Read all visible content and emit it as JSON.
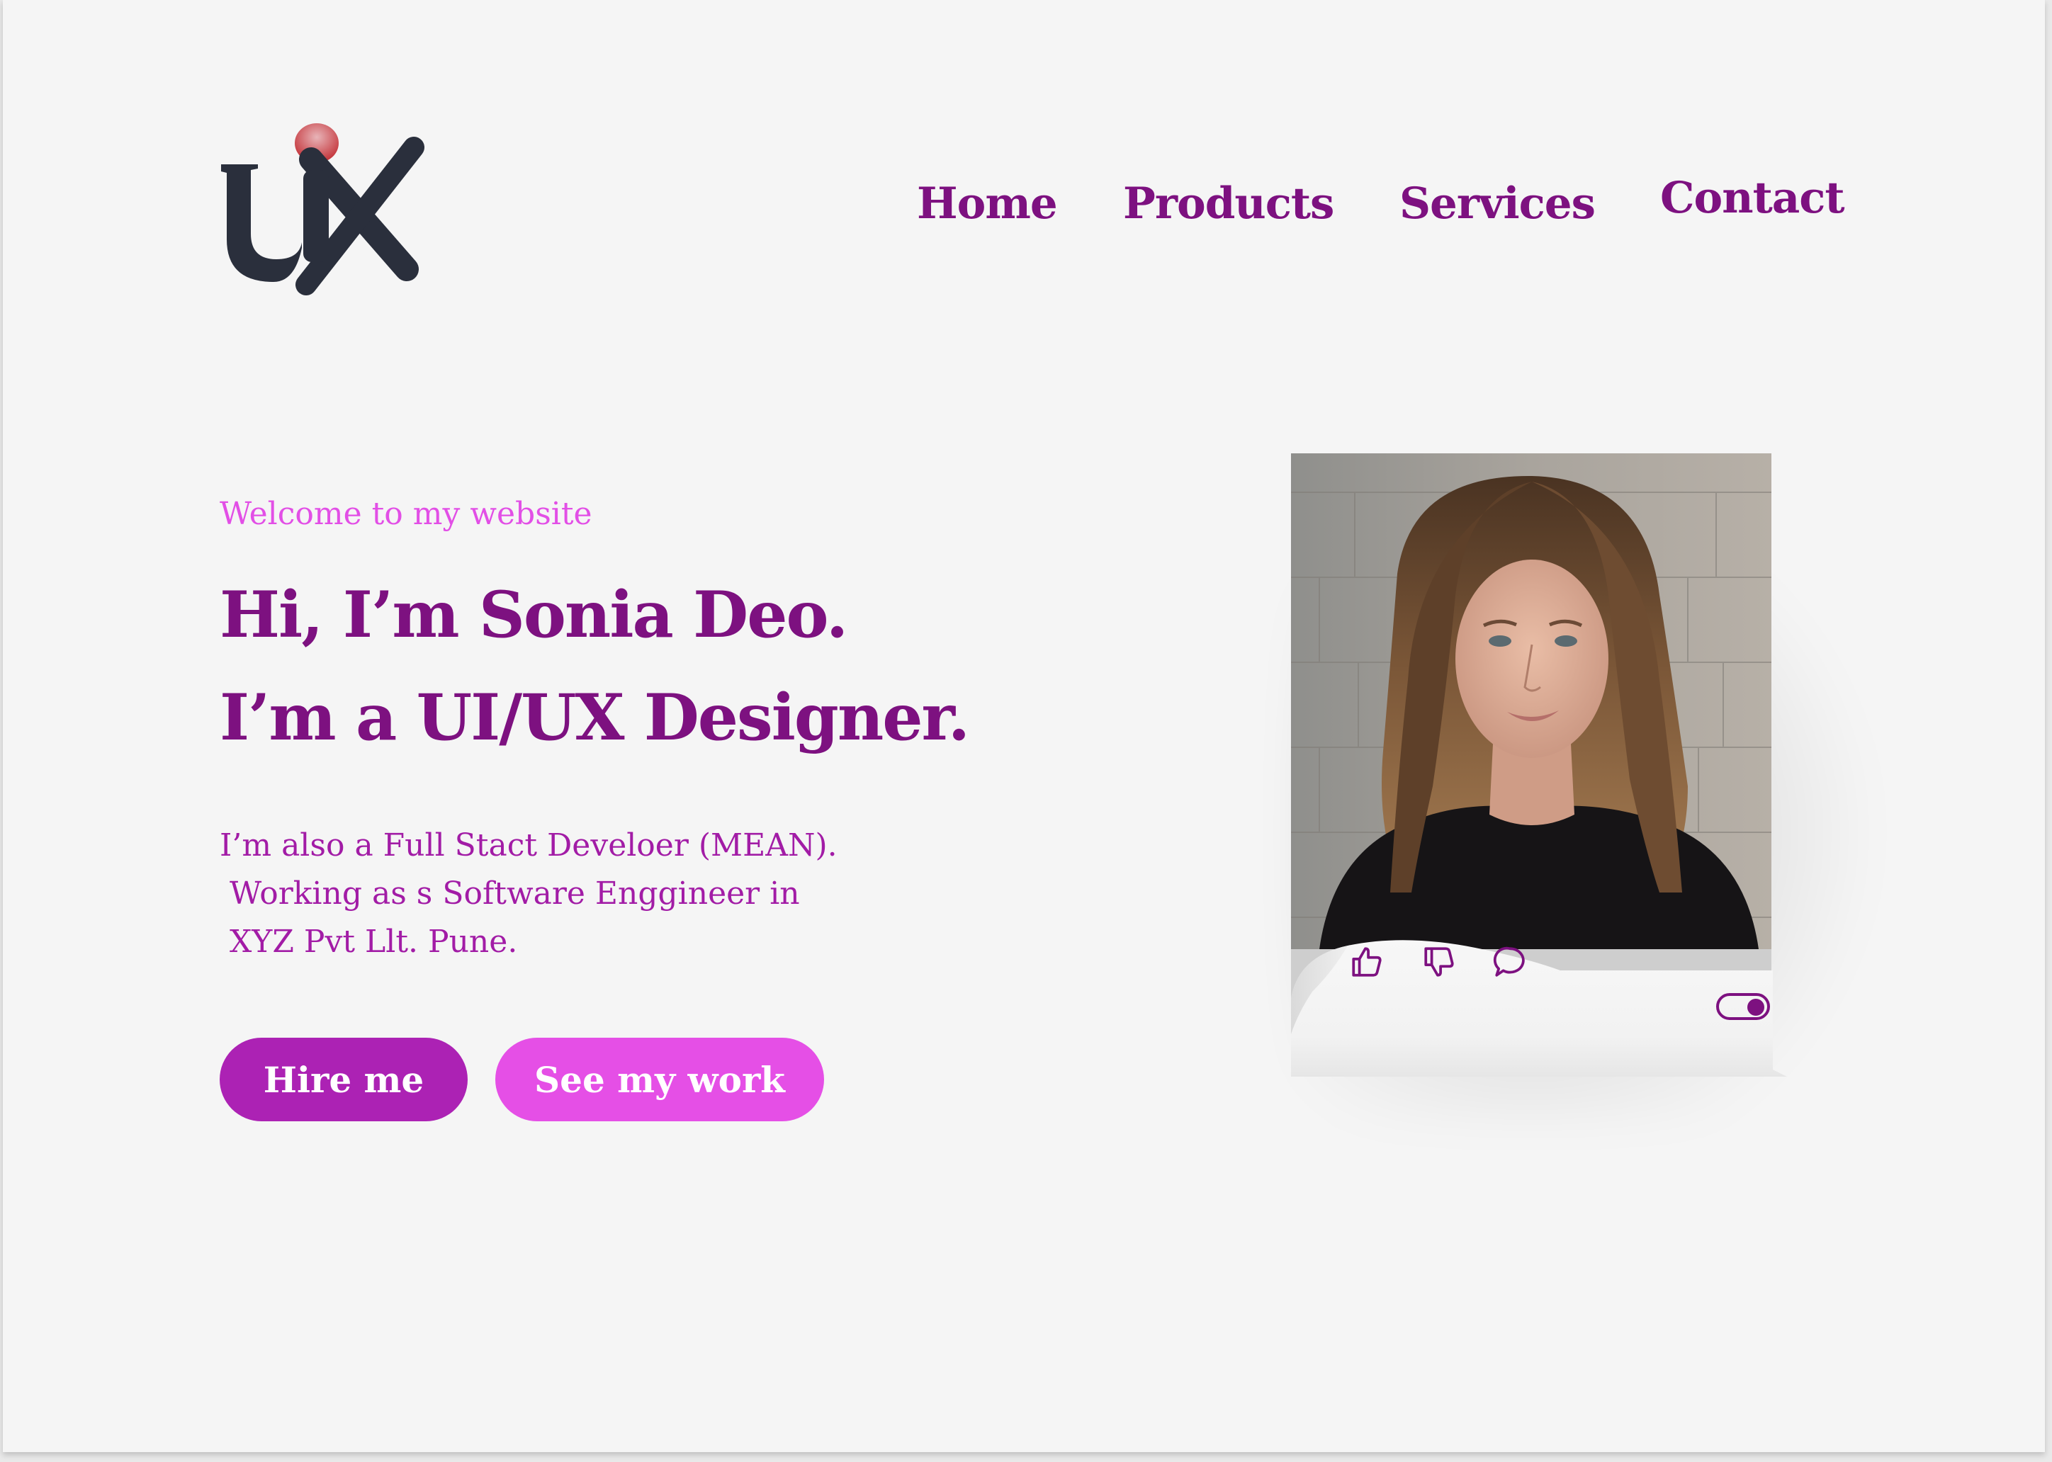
{
  "logo": {
    "text": "UX",
    "colors": {
      "letters": "#2a2f3c",
      "dot_top": "#e29aa0",
      "dot_bottom": "#c0272d"
    }
  },
  "nav": {
    "items": [
      {
        "label": "Home"
      },
      {
        "label": "Products"
      },
      {
        "label": "Services"
      },
      {
        "label": "Contact"
      }
    ]
  },
  "hero": {
    "welcome": "Welcome to my website",
    "headline_line1": "Hi, I’m Sonia Deo.",
    "headline_line2": "I’m a UI/UX Designer.",
    "bio_line1": "I’m also a Full Stact Develoer (MEAN).",
    "bio_line2": " Working as s Software Enggineer in",
    "bio_line3": " XYZ Pvt Llt. Pune.",
    "hire_button": "Hire me",
    "work_button": "See my work"
  },
  "card": {
    "icons": [
      "thumbs-up-icon",
      "thumbs-down-icon",
      "comment-icon"
    ],
    "toggle_state": "on"
  },
  "colors": {
    "page_background": "#f5f5f5",
    "primary_purple": "#7d1180",
    "button_hire": "#ac22b4",
    "button_work": "#e54fe6",
    "welcome_text": "#e24fe6",
    "bio_text": "#a21ca6"
  }
}
